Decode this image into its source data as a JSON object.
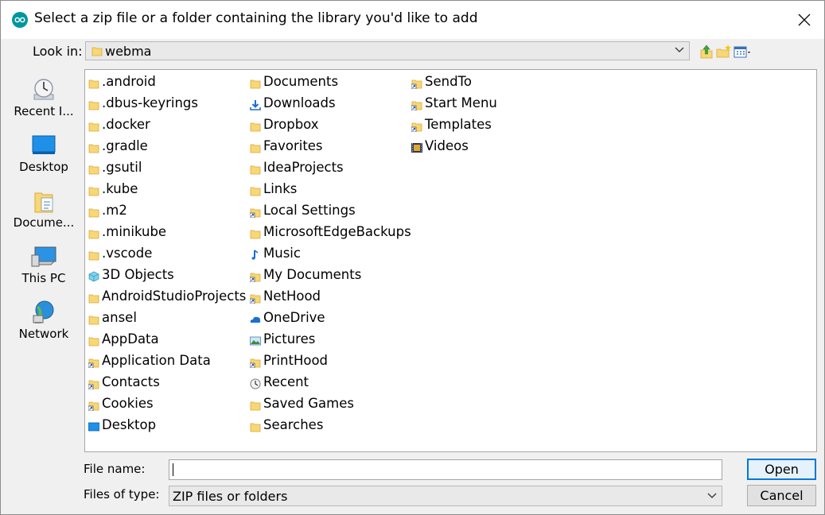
{
  "dialog": {
    "title": "Select a zip file or a folder containing the library you'd like to add",
    "accent": "#0078d7"
  },
  "look_in": {
    "label": "Look in:",
    "value": "webma"
  },
  "toolbar": {
    "icons": [
      "up-one-level-icon",
      "create-new-folder-icon",
      "view-menu-icon"
    ]
  },
  "places": [
    {
      "label": "Recent I...",
      "icon": "recent-items-icon"
    },
    {
      "label": "Desktop",
      "icon": "desktop-icon"
    },
    {
      "label": "Docume...",
      "icon": "documents-icon"
    },
    {
      "label": "This PC",
      "icon": "this-pc-icon"
    },
    {
      "label": "Network",
      "icon": "network-icon"
    }
  ],
  "files": {
    "column1": [
      {
        "name": ".android",
        "icon": "folder"
      },
      {
        "name": ".dbus-keyrings",
        "icon": "folder"
      },
      {
        "name": ".docker",
        "icon": "folder"
      },
      {
        "name": ".gradle",
        "icon": "folder"
      },
      {
        "name": ".gsutil",
        "icon": "folder"
      },
      {
        "name": ".kube",
        "icon": "folder"
      },
      {
        "name": ".m2",
        "icon": "folder"
      },
      {
        "name": ".minikube",
        "icon": "folder"
      },
      {
        "name": ".vscode",
        "icon": "folder"
      },
      {
        "name": "3D Objects",
        "icon": "3d-objects"
      },
      {
        "name": "AndroidStudioProjects",
        "icon": "folder"
      },
      {
        "name": "ansel",
        "icon": "folder"
      },
      {
        "name": "AppData",
        "icon": "folder"
      },
      {
        "name": "Application Data",
        "icon": "folder-shortcut"
      },
      {
        "name": "Contacts",
        "icon": "folder-shortcut"
      },
      {
        "name": "Cookies",
        "icon": "folder-shortcut"
      },
      {
        "name": "Desktop",
        "icon": "desktop"
      }
    ],
    "column2": [
      {
        "name": "Documents",
        "icon": "folder"
      },
      {
        "name": "Downloads",
        "icon": "downloads"
      },
      {
        "name": "Dropbox",
        "icon": "folder"
      },
      {
        "name": "Favorites",
        "icon": "folder"
      },
      {
        "name": "IdeaProjects",
        "icon": "folder"
      },
      {
        "name": "Links",
        "icon": "folder"
      },
      {
        "name": "Local Settings",
        "icon": "folder-shortcut"
      },
      {
        "name": "MicrosoftEdgeBackups",
        "icon": "folder"
      },
      {
        "name": "Music",
        "icon": "music"
      },
      {
        "name": "My Documents",
        "icon": "folder-shortcut"
      },
      {
        "name": "NetHood",
        "icon": "folder-shortcut"
      },
      {
        "name": "OneDrive",
        "icon": "onedrive"
      },
      {
        "name": "Pictures",
        "icon": "pictures"
      },
      {
        "name": "PrintHood",
        "icon": "folder-shortcut"
      },
      {
        "name": "Recent",
        "icon": "recent"
      },
      {
        "name": "Saved Games",
        "icon": "folder"
      },
      {
        "name": "Searches",
        "icon": "folder"
      }
    ],
    "column3": [
      {
        "name": "SendTo",
        "icon": "folder-shortcut"
      },
      {
        "name": "Start Menu",
        "icon": "folder-shortcut"
      },
      {
        "name": "Templates",
        "icon": "folder-shortcut"
      },
      {
        "name": "Videos",
        "icon": "videos"
      }
    ]
  },
  "file_name": {
    "label": "File name:",
    "value": ""
  },
  "file_type": {
    "label": "Files of type:",
    "value": "ZIP files or folders"
  },
  "buttons": {
    "open": "Open",
    "cancel": "Cancel"
  }
}
